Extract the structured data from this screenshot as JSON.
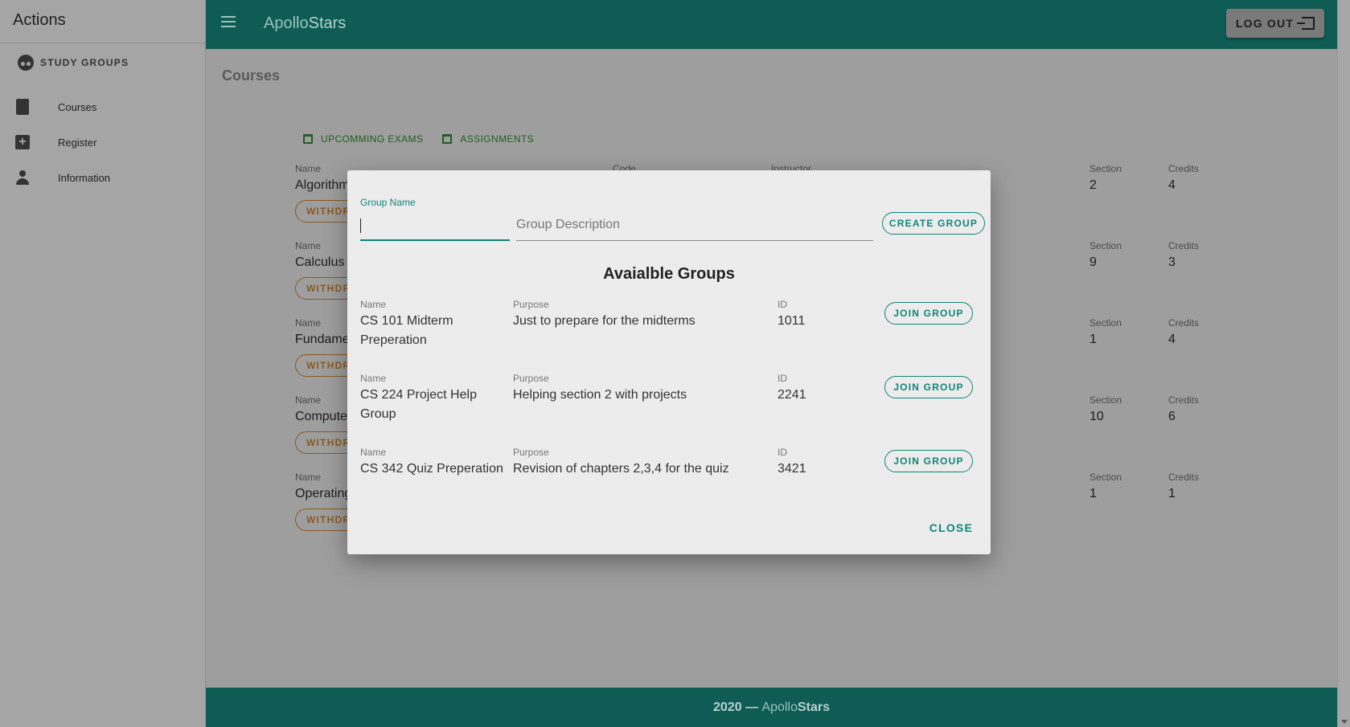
{
  "sidebar": {
    "title": "Actions",
    "study_groups": "STUDY GROUPS",
    "items": [
      {
        "label": "Courses"
      },
      {
        "label": "Register"
      },
      {
        "label": "Information"
      }
    ]
  },
  "appbar": {
    "brand_part1": "Apollo",
    "brand_part2": "Stars",
    "logout_label": "LOG OUT"
  },
  "main": {
    "page_title": "Courses",
    "tabs": [
      {
        "label": "UPCOMMING EXAMS"
      },
      {
        "label": "ASSIGNMENTS"
      }
    ],
    "columns": {
      "name": "Name",
      "code": "Code",
      "instructor": "Instructor",
      "section": "Section",
      "credits": "Credits"
    },
    "withdraw_label": "WITHDR",
    "courses": [
      {
        "name": "Algorithm",
        "section": "2",
        "credits": "4"
      },
      {
        "name": "Calculus",
        "section": "9",
        "credits": "3"
      },
      {
        "name": "Fundame",
        "section": "1",
        "credits": "4"
      },
      {
        "name": "Compute",
        "section": "10",
        "credits": "6"
      },
      {
        "name": "Operating",
        "section": "1",
        "credits": "1"
      }
    ]
  },
  "dialog": {
    "group_name_label": "Group Name",
    "group_name_value": "",
    "group_description_placeholder": "Group Description",
    "create_label": "CREATE GROUP",
    "groups_title": "Avaialble Groups",
    "col_name": "Name",
    "col_purpose": "Purpose",
    "col_id": "ID",
    "join_label": "JOIN GROUP",
    "groups": [
      {
        "name": "CS 101 Midterm Preperation",
        "purpose": "Just to prepare for the midterms",
        "id": "1011"
      },
      {
        "name": "CS 224 Project Help Group",
        "purpose": "Helping section 2 with projects",
        "id": "2241"
      },
      {
        "name": "CS 342 Quiz Preperation",
        "purpose": "Revision of chapters 2,3,4 for the quiz",
        "id": "3421"
      }
    ],
    "close_label": "CLOSE"
  },
  "footer": {
    "prefix": "2020 — ",
    "brand_part1": "Apollo",
    "brand_part2": "Stars"
  },
  "colors": {
    "primary": "#00796b",
    "accent": "#009688",
    "withdraw": "#ef8c00"
  }
}
